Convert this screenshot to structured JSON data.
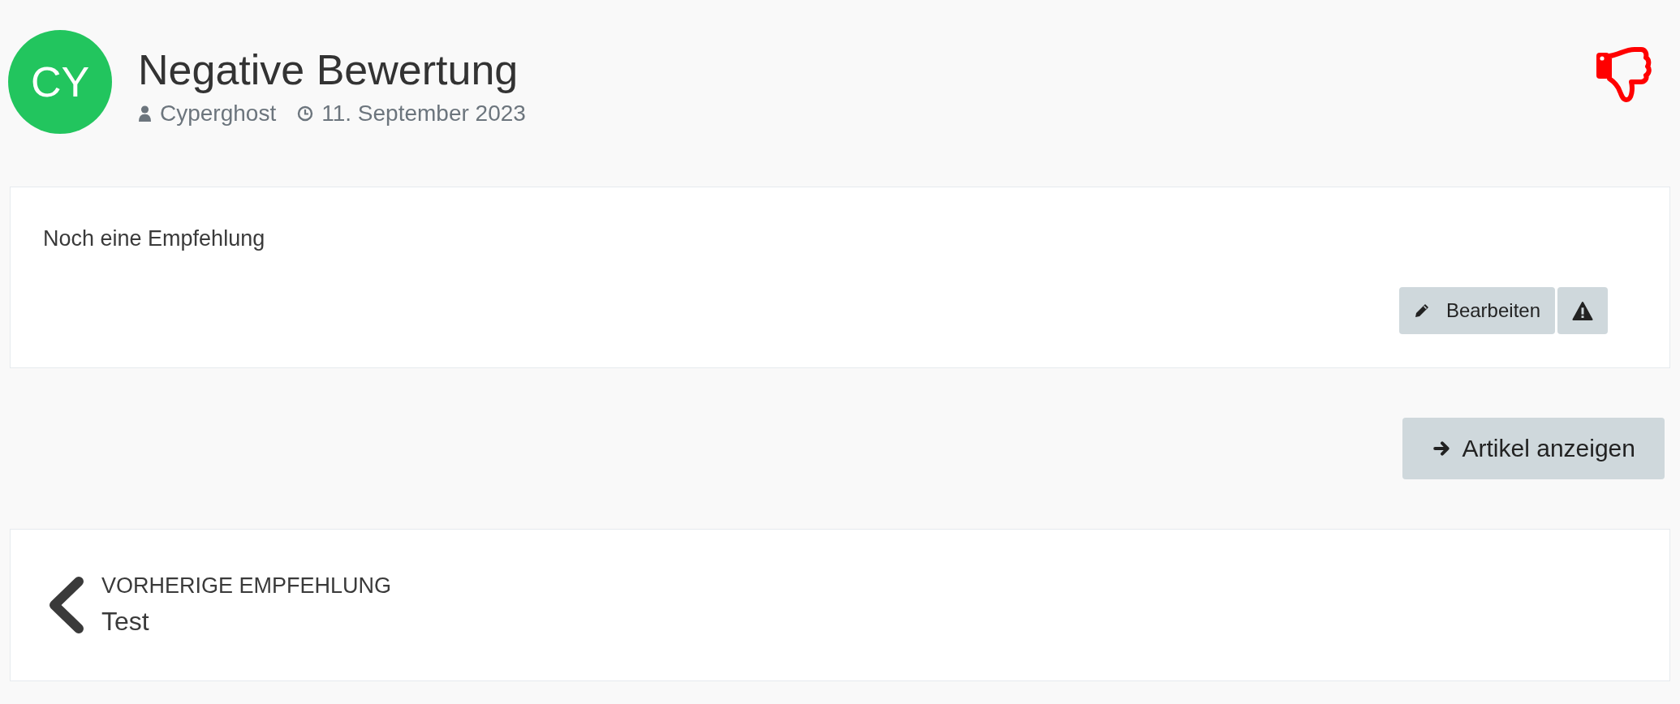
{
  "header": {
    "avatar_initials": "CY",
    "title": "Negative Bewertung",
    "author": "Cyperghost",
    "date": "11. September 2023",
    "recommended": false
  },
  "review": {
    "text": "Noch eine Empfehlung",
    "buttons": [
      {
        "kind": "edit",
        "label": "Bearbeiten"
      },
      {
        "kind": "report"
      }
    ]
  },
  "article_button": {
    "label": "Artikel anzeigen"
  },
  "previous": {
    "label": "VORHERIGE EMPFEHLUNG",
    "title": "Test"
  }
}
